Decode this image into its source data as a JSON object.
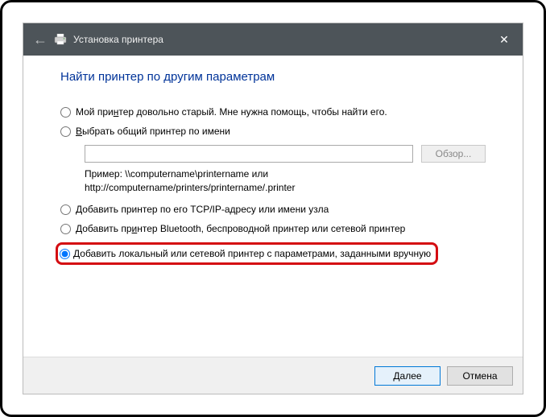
{
  "titlebar": {
    "title": "Установка принтера",
    "close_symbol": "✕"
  },
  "heading": "Найти принтер по другим параметрам",
  "options": {
    "old": {
      "pre": "Мой при",
      "u": "н",
      "post": "тер довольно старый. Мне нужна помощь, чтобы найти его."
    },
    "shared": {
      "pre": "",
      "u": "В",
      "post": "ыбрать общий принтер по имени"
    },
    "browse_label": "Обзор...",
    "example_line1": "Пример: \\\\computername\\printername или",
    "example_line2": "http://computername/printers/printername/.printer",
    "tcpip": "Добавить принтер по его TCP/IP-адресу или имени узла",
    "bluetooth": {
      "pre": "Добавить пр",
      "u": "и",
      "post": "нтер Bluetooth, беспроводной принтер или сетевой принтер"
    },
    "manual": {
      "pre": "",
      "u": "Д",
      "post": "обавить локальный или сетевой принтер с параметрами, заданными вручную"
    }
  },
  "footer": {
    "next": "Далее",
    "cancel": "Отмена"
  }
}
